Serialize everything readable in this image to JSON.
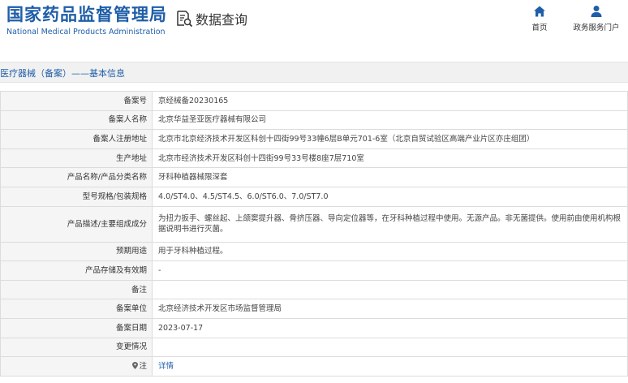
{
  "header": {
    "brand_cn": "国家药品监督管理局",
    "brand_en": "National Medical Products Administration",
    "query_label": "数据查询",
    "nav": {
      "home": "首页",
      "portal": "政务服务门户"
    }
  },
  "breadcrumb": "医疗器械（备案）——基本信息",
  "colors": {
    "brand_blue": "#1f5ea8",
    "label_bg": "#f5f5f5",
    "crumb_bg": "#f1f1f1"
  },
  "rows": [
    {
      "label": "备案号",
      "value": "京经械备20230165"
    },
    {
      "label": "备案人名称",
      "value": "北京华益圣亚医疗器械有限公司"
    },
    {
      "label": "备案人注册地址",
      "value": "北京市北京经济技术开发区科创十四街99号33幢6层B单元701-6室（北京自贸试验区高端产业片区亦庄组团）"
    },
    {
      "label": "生产地址",
      "value": "北京市经济技术开发区科创十四街99号33号楼8座7层710室"
    },
    {
      "label": "产品名称/产品分类名称",
      "value": "牙科种植器械限深套"
    },
    {
      "label": "型号规格/包装规格",
      "value": "4.0/ST4.0、4.5/ST4.5、6.0/ST6.0、7.0/ST7.0"
    },
    {
      "label": "产品描述/主要组成成分",
      "value": "为扭力扳手、螺丝起、上颌窦提升器、骨挤压器、导向定位器等，在牙科种植过程中使用。无源产品。非无菌提供。使用前由使用机构根据说明书进行灭菌。"
    },
    {
      "label": "预期用途",
      "value": "用于牙科种植过程。"
    },
    {
      "label": "产品存储及有效期",
      "value": "-"
    },
    {
      "label": "备注",
      "value": ""
    },
    {
      "label": "备案单位",
      "value": "北京经济技术开发区市场监督管理局"
    },
    {
      "label": "备案日期",
      "value": "2023-07-17"
    },
    {
      "label": "变更情况",
      "value": ""
    },
    {
      "label": "注",
      "value": "详情"
    }
  ]
}
